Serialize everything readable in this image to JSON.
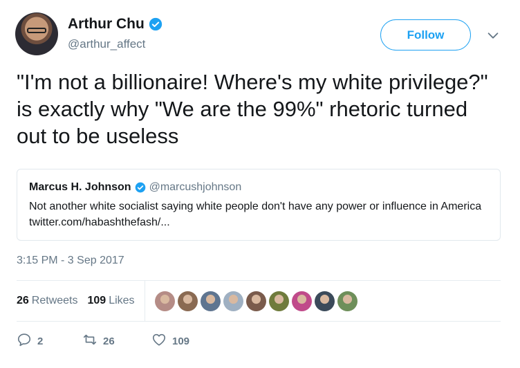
{
  "author": {
    "display_name": "Arthur Chu",
    "handle": "@arthur_affect",
    "verified": true
  },
  "follow_button": {
    "label": "Follow"
  },
  "tweet": {
    "text": "\"I'm not a billionaire! Where's my white privilege?\" is exactly why \"We are the 99%\" rhetoric turned out to be useless",
    "timestamp": "3:15 PM - 3 Sep 2017"
  },
  "quoted_tweet": {
    "display_name": "Marcus H. Johnson",
    "handle": "@marcushjohnson",
    "verified": true,
    "text": "Not another white socialist saying white people don't have any power or influence in America twitter.com/habashthefash/..."
  },
  "stats": {
    "retweets_count": "26",
    "retweets_label": "Retweets",
    "likes_count": "109",
    "likes_label": "Likes"
  },
  "likers": [
    {
      "color": "#b58c86"
    },
    {
      "color": "#8a6a52"
    },
    {
      "color": "#5f7590"
    },
    {
      "color": "#9fb0c2"
    },
    {
      "color": "#7a5b4c"
    },
    {
      "color": "#6f7b3c"
    },
    {
      "color": "#c04a8a"
    },
    {
      "color": "#3b4a5a"
    },
    {
      "color": "#6e8f5a"
    }
  ],
  "actions": {
    "replies": "2",
    "retweets": "26",
    "likes": "109"
  },
  "colors": {
    "accent": "#1da1f2",
    "secondary_text": "#657786",
    "primary_text": "#14171a",
    "border": "#e1e8ed"
  }
}
